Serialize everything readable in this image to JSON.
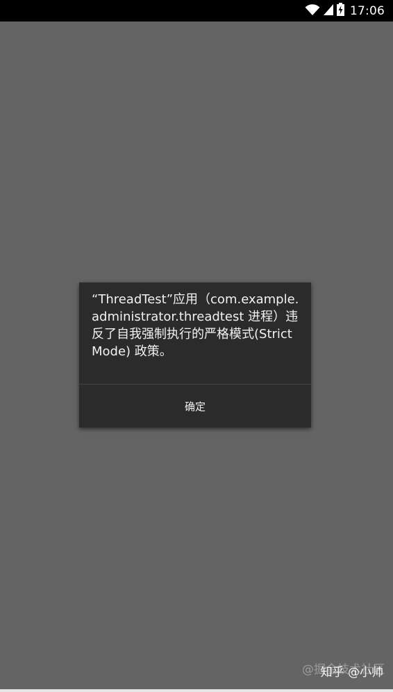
{
  "status_bar": {
    "time": "17:06",
    "icons": [
      "wifi-icon",
      "signal-icon",
      "battery-charging-icon"
    ]
  },
  "dialog": {
    "message": "“ThreadTest”应用（com.example.administrator.threadtest 进程）违反了自我强制执行的严格模式(StrictMode) 政策。",
    "ok_button": "确定"
  },
  "watermark": {
    "juejin": "@掘金技术社区",
    "zhihu": "知乎 @小帅"
  },
  "colors": {
    "background": "#646464",
    "dialog": "#2b2b2b",
    "status_bar": "#000000"
  }
}
